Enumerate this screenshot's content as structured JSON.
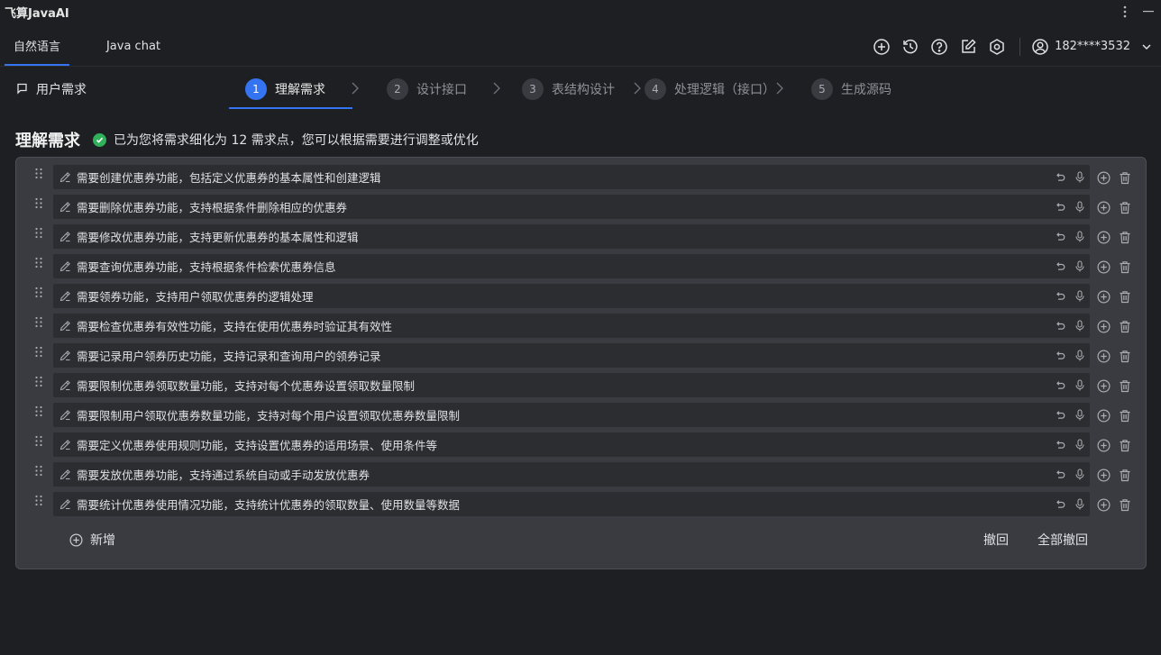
{
  "app": {
    "title": "飞算JavaAI"
  },
  "tabs": [
    {
      "label": "自然语言",
      "active": true
    },
    {
      "label": "Java chat",
      "active": false
    }
  ],
  "toolbar": {
    "icons": [
      "add-circle-icon",
      "history-icon",
      "help-icon",
      "edit-icon",
      "settings-hex-icon"
    ],
    "user_phone": "182****3532"
  },
  "steps_bar": {
    "requirement_label": "用户需求",
    "steps": [
      {
        "num": "1",
        "label": "理解需求",
        "active": true
      },
      {
        "num": "2",
        "label": "设计接口",
        "active": false
      },
      {
        "num": "3",
        "label": "表结构设计",
        "active": false
      },
      {
        "num": "4",
        "label": "处理逻辑（接口）",
        "active": false
      },
      {
        "num": "5",
        "label": "生成源码",
        "active": false
      }
    ]
  },
  "heading": {
    "title": "理解需求",
    "message": "已为您将需求细化为 12 需求点，您可以根据需要进行调整或优化"
  },
  "requirements": [
    "需要创建优惠券功能，包括定义优惠券的基本属性和创建逻辑",
    "需要删除优惠券功能，支持根据条件删除相应的优惠券",
    "需要修改优惠券功能，支持更新优惠券的基本属性和逻辑",
    "需要查询优惠券功能，支持根据条件检索优惠券信息",
    "需要领券功能，支持用户领取优惠券的逻辑处理",
    "需要检查优惠券有效性功能，支持在使用优惠券时验证其有效性",
    "需要记录用户领券历史功能，支持记录和查询用户的领券记录",
    "需要限制优惠券领取数量功能，支持对每个优惠券设置领取数量限制",
    "需要限制用户领取优惠券数量功能，支持对每个用户设置领取优惠券数量限制",
    "需要定义优惠券使用规则功能，支持设置优惠券的适用场景、使用条件等",
    "需要发放优惠券功能，支持通过系统自动或手动发放优惠券",
    "需要统计优惠券使用情况功能，支持统计优惠券的领取数量、使用数量等数据"
  ],
  "actions": {
    "add_label": "新增",
    "undo_label": "撤回",
    "undo_all_label": "全部撤回"
  },
  "colors": {
    "accent": "#3574f0",
    "success": "#30b05a",
    "background": "#1e1f22",
    "panel": "#393b40"
  }
}
